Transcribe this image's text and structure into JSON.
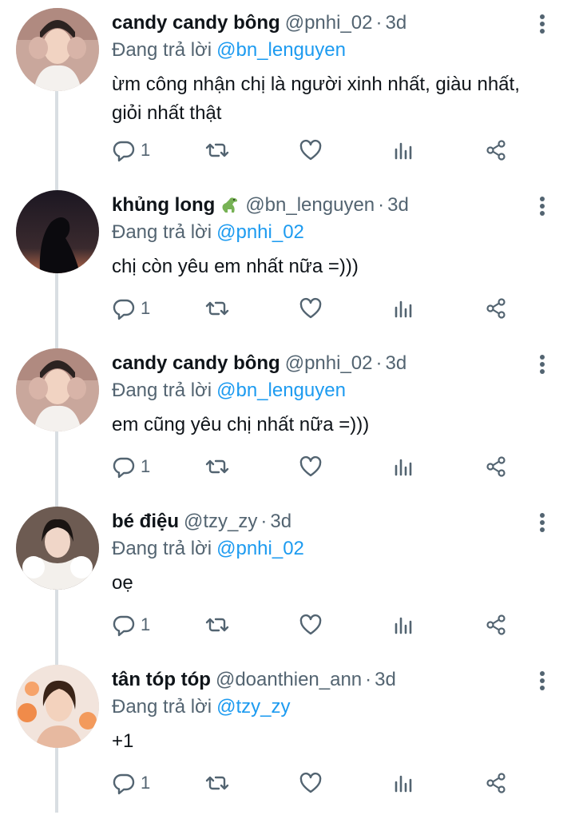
{
  "replying_prefix": "Đang trả lời",
  "tweets": [
    {
      "name": "candy candy bông",
      "handle": "@pnhi_02",
      "time": "3d",
      "reply_to": "@bn_lenguyen",
      "text": "ừm công nhận chị là người xinh nhất, giàu nhất, giỏi nhất thật",
      "reply_count": "1"
    },
    {
      "name": "khủng long",
      "handle": "@bn_lenguyen",
      "time": "3d",
      "reply_to": "@pnhi_02",
      "text": "chị còn yêu em nhất nữa =)))",
      "reply_count": "1",
      "name_emoji": "dinosaur-emoji"
    },
    {
      "name": "candy candy bông",
      "handle": "@pnhi_02",
      "time": "3d",
      "reply_to": "@bn_lenguyen",
      "text": "em cũng yêu chị nhất nữa =)))",
      "reply_count": "1"
    },
    {
      "name": "bé điệu",
      "handle": "@tzy_zy",
      "time": "3d",
      "reply_to": "@pnhi_02",
      "text": "oẹ",
      "reply_count": "1"
    },
    {
      "name": "tân tóp tóp",
      "handle": "@doanthien_ann",
      "time": "3d",
      "reply_to": "@tzy_zy",
      "text": "+1",
      "reply_count": "1"
    }
  ],
  "colors": {
    "text": "#0f1419",
    "muted": "#536471",
    "link": "#1d9bf0",
    "thread_line": "#d9dee2"
  },
  "icons": [
    "reply-icon",
    "retweet-icon",
    "like-icon",
    "analytics-icon",
    "share-icon",
    "more-icon"
  ]
}
